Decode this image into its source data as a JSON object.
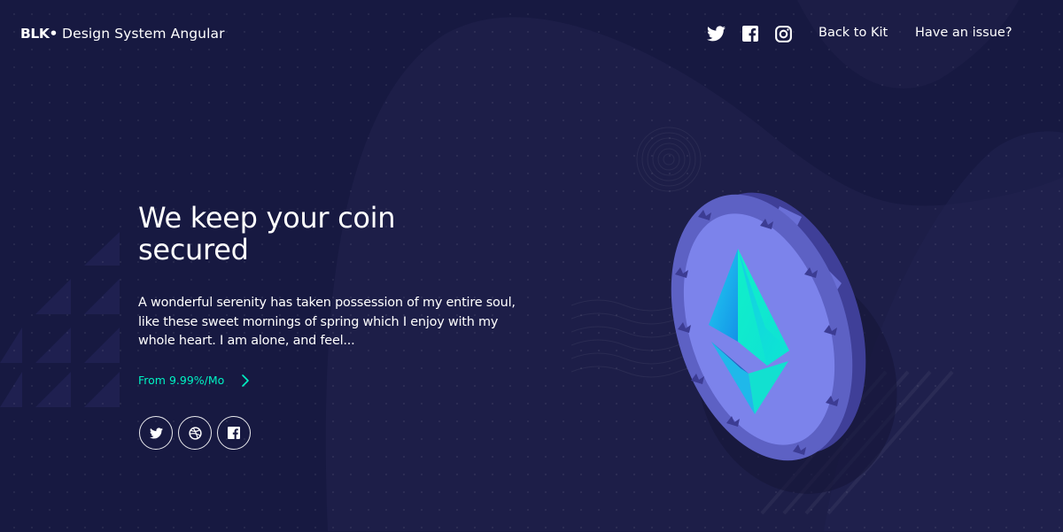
{
  "navbar": {
    "brand_bold": "BLK•",
    "brand_text": "Design System Angular",
    "social_icons": [
      "twitter-icon",
      "facebook-icon",
      "instagram-icon"
    ],
    "links": [
      {
        "label": "Back to Kit"
      },
      {
        "label": "Have an issue?"
      }
    ]
  },
  "hero": {
    "title_line1": "We keep your coin",
    "title_line2": "secured",
    "description": "A wonderful serenity has taken possession of my entire soul, like these sweet mornings of spring which I enjoy with my whole heart. I am alone, and feel...",
    "price_link": "From 9.99%/Mo",
    "price_arrow_icon": "chevron-right-icon",
    "social_buttons": [
      "twitter-icon",
      "dribbble-icon",
      "facebook-icon"
    ]
  },
  "illustration": {
    "subject": "ethereum-coin",
    "icon": "ethereum-icon"
  },
  "colors": {
    "background": "#171941",
    "accent": "#00f2c3",
    "coin_face": "#7c83eb",
    "coin_rim": "#5d61c4",
    "coin_edge": "#3f3f98"
  }
}
